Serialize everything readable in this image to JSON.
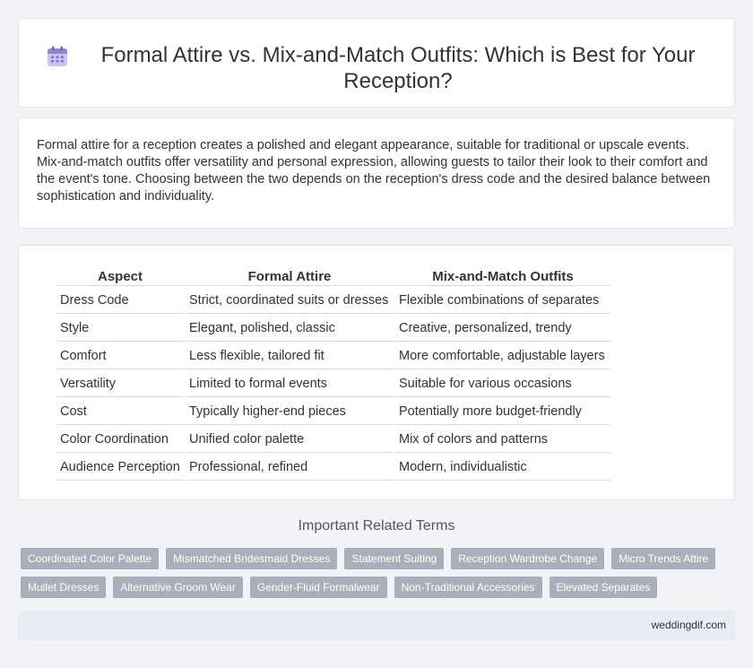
{
  "header": {
    "title": "Formal Attire vs. Mix-and-Match Outfits: Which is Best for Your Reception?",
    "icon": "calendar-icon"
  },
  "intro": {
    "text": "Formal attire for a reception creates a polished and elegant appearance, suitable for traditional or upscale events. Mix-and-match outfits offer versatility and personal expression, allowing guests to tailor their look to their comfort and the event's tone. Choosing between the two depends on the reception's dress code and the desired balance between sophistication and individuality."
  },
  "table": {
    "headers": [
      "Aspect",
      "Formal Attire",
      "Mix-and-Match Outfits"
    ],
    "rows": [
      [
        "Dress Code",
        "Strict, coordinated suits or dresses",
        "Flexible combinations of separates"
      ],
      [
        "Style",
        "Elegant, polished, classic",
        "Creative, personalized, trendy"
      ],
      [
        "Comfort",
        "Less flexible, tailored fit",
        "More comfortable, adjustable layers"
      ],
      [
        "Versatility",
        "Limited to formal events",
        "Suitable for various occasions"
      ],
      [
        "Cost",
        "Typically higher-end pieces",
        "Potentially more budget-friendly"
      ],
      [
        "Color Coordination",
        "Unified color palette",
        "Mix of colors and patterns"
      ],
      [
        "Audience Perception",
        "Professional, refined",
        "Modern, individualistic"
      ]
    ]
  },
  "related": {
    "title": "Important Related Terms",
    "tags_row1": [
      "Coordinated Color Palette",
      "Mismatched Bridesmaid Dresses",
      "Statement Suiting",
      "Reception Wardrobe Change",
      "Micro Trends Attire"
    ],
    "tags_row2": [
      "Mullet Dresses",
      "Alternative Groom Wear",
      "Gender-Fluid Formalwear",
      "Non-Traditional Accessories",
      "Elevated Separates"
    ]
  },
  "footer": {
    "site": "weddingdif.com"
  },
  "colors": {
    "tag_bg": "#a9b0bb",
    "footer_bg": "#e7ecf5",
    "page_bg": "#f1f3f6"
  }
}
